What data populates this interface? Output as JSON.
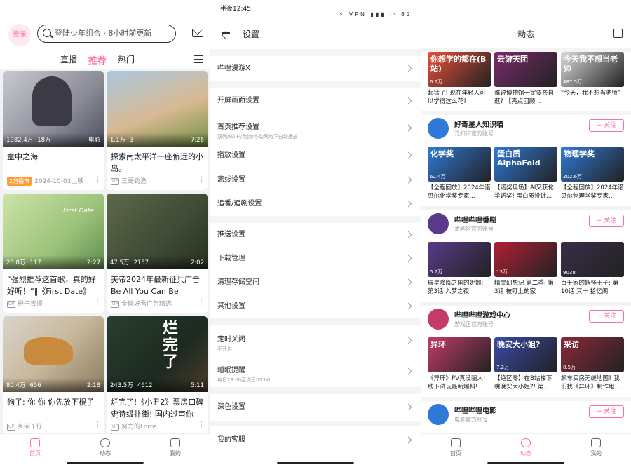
{
  "left": {
    "login": "登录",
    "search_placeholder": "登陆少年组合 · 8小时前更新",
    "tabs": [
      "直播",
      "推荐",
      "热门"
    ],
    "cards": [
      {
        "views": "1082.4万",
        "likes": "18万",
        "dur": "电影",
        "title": "盒中之海",
        "meta": "2024-10-03上映",
        "tag": "2万播市"
      },
      {
        "views": "1.1万",
        "likes": "3",
        "dur": "7:26",
        "title": "探索南太平洋一座偏远的小岛。",
        "meta": "三哥钓渔"
      },
      {
        "views": "23.8万",
        "likes": "117",
        "dur": "2:27",
        "title": "“强烈推荐这首歌，真的好好听！”‖《First Date》",
        "meta": "橙子青提",
        "overlay": "First Date"
      },
      {
        "views": "47.5万",
        "likes": "2157",
        "dur": "2:02",
        "title": "美帝2024年最新征兵广告 Be All You Can Be",
        "meta": "全球好看广告精选"
      },
      {
        "views": "80.4万",
        "likes": "656",
        "dur": "2:18",
        "title": "狗子: 你 你 你先放下棍子",
        "meta": "乡间丫仔"
      },
      {
        "views": "243.5万",
        "likes": "4612",
        "dur": "5:11",
        "title": "烂完了!《小丑2》票房口碑史诗级扑街! 国内过审你还...",
        "meta": "努力的Lorre",
        "overlay": "烂完了"
      }
    ],
    "nav": [
      "首页",
      "动态",
      "我的"
    ]
  },
  "middle": {
    "status_time": "半夜12:45",
    "status_icons": "⚡ VPN ▮▮▮ ◠ 82",
    "title": "设置",
    "rows": [
      {
        "label": "哔哩漫游X"
      },
      {
        "label": "开屏画面设置"
      },
      {
        "label": "首页推荐设置",
        "sub": "双列/Wi-Fi/免流/移动网络下自动播放"
      },
      {
        "label": "播放设置"
      },
      {
        "label": "离线设置"
      },
      {
        "label": "追番/追剧设置"
      },
      {
        "label": "推送设置"
      },
      {
        "label": "下载管理"
      },
      {
        "label": "清理存储空间"
      },
      {
        "label": "其他设置"
      },
      {
        "label": "定时关闭",
        "sub": "不开启"
      },
      {
        "label": "睡眠提醒",
        "sub": "每日23:00至次日07:00"
      },
      {
        "label": "深色设置"
      },
      {
        "label": "我的客服"
      }
    ]
  },
  "right": {
    "title": "动态",
    "top_videos": [
      {
        "title": "起猛了! 现在年轻人可以学得这么花?",
        "count": "6.7万",
        "overlay": "你想学的都在(B站)"
      },
      {
        "title": "谁说博物馆一定要亲自逛? 【亮点回顾...",
        "count": "",
        "overlay": "云游天团"
      },
      {
        "title": "“今天，我不想当老师”",
        "count": "487.5万",
        "overlay": "今天我不想当老师"
      }
    ],
    "groups": [
      {
        "name": "好奇星人知识喵",
        "desc": "泛知识官方账号",
        "follow": "+ 关注",
        "videos": [
          {
            "title": "【全程回放】2024年诺贝尔化学奖专家...",
            "count": "62.4万",
            "overlay": "化学奖"
          },
          {
            "title": "【诺奖现场】AI又获化学诺奖! 蛋白质设计...",
            "count": "",
            "overlay": "蛋白质 AlphaFold"
          },
          {
            "title": "【全程回放】2024年诺贝尔物理学奖专家...",
            "count": "202.6万",
            "overlay": "物理学奖"
          }
        ]
      },
      {
        "name": "哔哩哔哩番剧",
        "desc": "番剧区官方账号",
        "follow": "+ 关注",
        "videos": [
          {
            "title": "辰星降临之国的妮娜: 第3话 入梦之夜",
            "count": "5.2万",
            "overlay": ""
          },
          {
            "title": "精灵幻想记 第二季: 第3话 被盯上的家",
            "count": "13万",
            "overlay": ""
          },
          {
            "title": "百千家的妖怪王子: 第10话 其十 拾忆阁",
            "count": "9038",
            "overlay": ""
          }
        ]
      },
      {
        "name": "哔哩哔哩游戏中心",
        "desc": "游戏区官方账号",
        "follow": "+ 关注",
        "videos": [
          {
            "title": "《异环》PV真没骗人! 线下试玩最新爆料!",
            "count": "",
            "overlay": "异环"
          },
          {
            "title": "【绝区零】在B站楼下跳晚安大小姐?! 第...",
            "count": "7.2万",
            "overlay": "晚安大小姐?"
          },
          {
            "title": "飙车买房无缝地图? 我们找《异环》制作组...",
            "count": "8.5万",
            "overlay": "采访"
          }
        ]
      },
      {
        "name": "哔哩哔哩电影",
        "desc": "电影官方账号",
        "follow": "+ 关注",
        "videos": []
      }
    ],
    "nav": [
      "首页",
      "动态",
      "我的"
    ]
  }
}
